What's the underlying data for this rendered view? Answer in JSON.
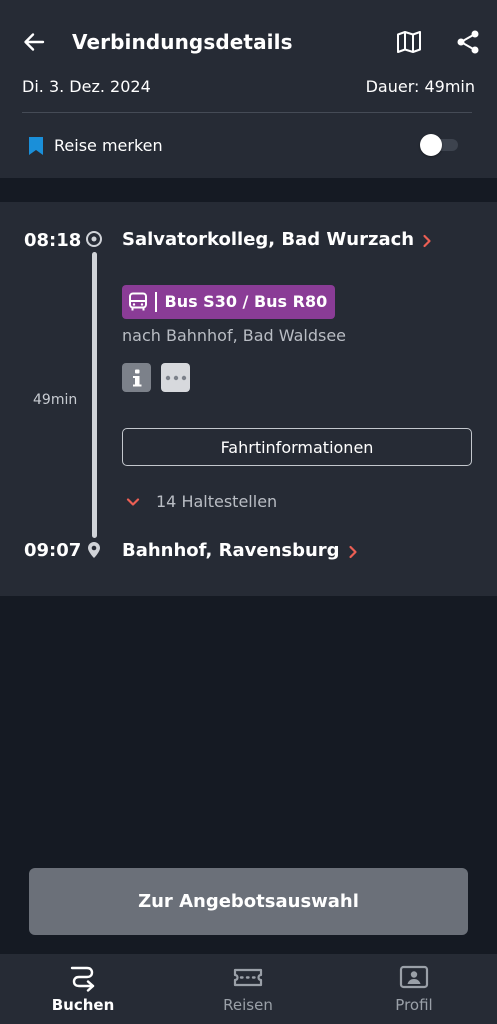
{
  "header": {
    "title": "Verbindungsdetails",
    "date": "Di. 3. Dez. 2024",
    "duration": "Dauer: 49min"
  },
  "save_trip": {
    "label": "Reise merken",
    "enabled": false
  },
  "connection": {
    "departure": {
      "time": "08:18",
      "station": "Salvatorkolleg, Bad Wurzach"
    },
    "travel_time": "49min",
    "line": {
      "label": "Bus S30 / Bus R80",
      "color": "#8a3c96"
    },
    "direction": "nach Bahnhof, Bad Waldsee",
    "trip_info_button": "Fahrtinformationen",
    "stops_toggle": "14 Haltestellen",
    "arrival": {
      "time": "09:07",
      "station": "Bahnhof, Ravensburg"
    }
  },
  "offer_button": "Zur Angebotsauswahl",
  "bottom_nav": {
    "items": [
      {
        "label": "Buchen",
        "icon": "route-icon",
        "active": true
      },
      {
        "label": "Reisen",
        "icon": "ticket-icon",
        "active": false
      },
      {
        "label": "Profil",
        "icon": "profile-card-icon",
        "active": false
      }
    ]
  },
  "colors": {
    "background": "#151a23",
    "surface": "#262b35",
    "accent_red": "#ec5f54",
    "bookmark_blue": "#1a8fd9"
  }
}
